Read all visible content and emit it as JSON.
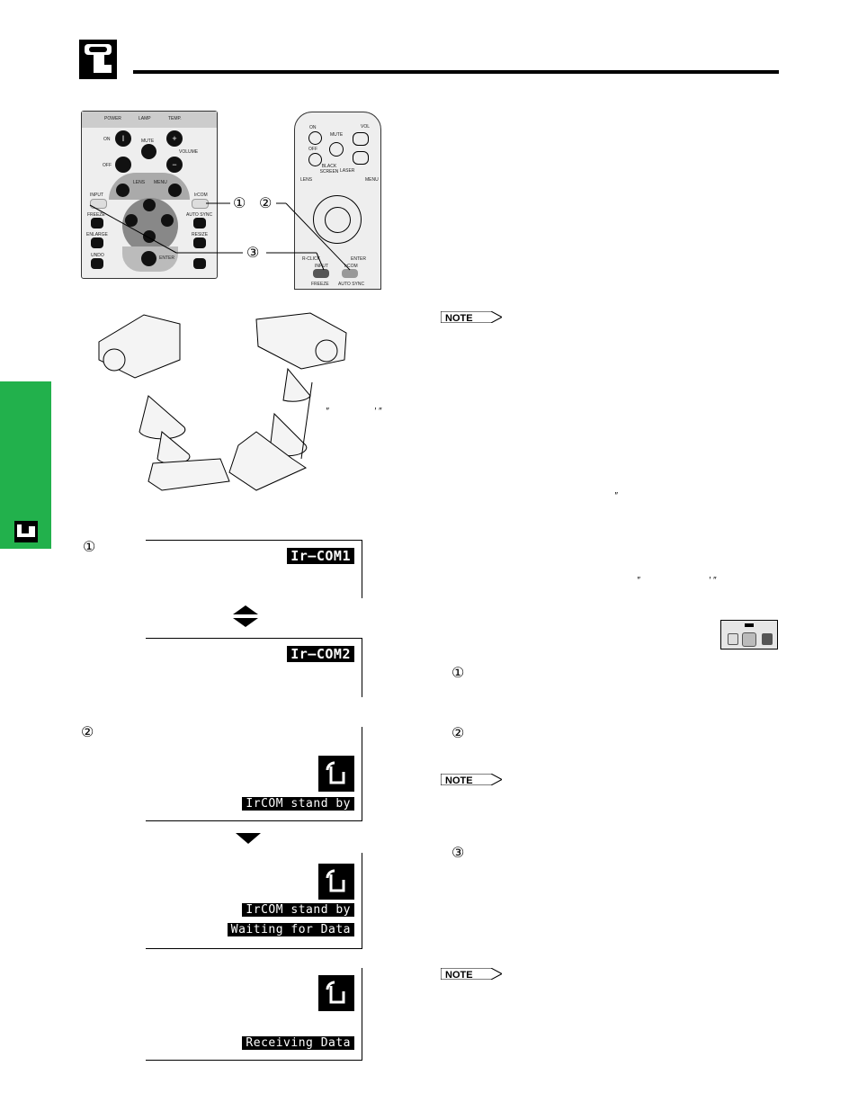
{
  "header": {
    "icon": "hand-pointer-icon"
  },
  "side_tab": {
    "color": "#22b14c",
    "icon": "projector-laptop-icon"
  },
  "remote_large": {
    "indicators": [
      "POWER",
      "LAMP",
      "TEMP."
    ],
    "labels": {
      "on": "ON",
      "mute": "MUTE",
      "volume": "VOLUME",
      "off": "OFF",
      "lens": "LENS",
      "menu": "MENU",
      "input": "INPUT",
      "ircom": "IrCOM",
      "freeze": "FREEZE",
      "auto_sync": "AUTO SYNC",
      "enlarge": "ENLARGE",
      "resize": "RESIZE",
      "undo": "UNDO",
      "enter": "ENTER"
    },
    "on_glyph": "I",
    "plus": "+",
    "minus": "−"
  },
  "remote_small": {
    "labels": {
      "on": "ON",
      "mute": "MUTE",
      "vol": "VOL",
      "off": "OFF",
      "black_screen": "BLACK SCREEN",
      "laser": "LASER",
      "lens": "LENS",
      "menu": "MENU",
      "r_click": "R-CLICK",
      "enter": "ENTER",
      "input": "INPUT",
      "ircom": "IrCOM",
      "freeze": "FREEZE",
      "auto_sync": "AUTO SYNC"
    }
  },
  "callouts": {
    "one": "①",
    "two": "②",
    "three": "③"
  },
  "quotes": {
    "q1": "″",
    "q2": "′ ″",
    "q3": "″",
    "q4": "″",
    "q5": "′ ″"
  },
  "osd": {
    "ircom1": "Ir—COM1",
    "ircom2": "Ir—COM2",
    "standby": "IrCOM stand by",
    "waiting": "Waiting for Data",
    "receiving": "Receiving Data"
  },
  "notes": [
    "NOTE",
    "NOTE",
    "NOTE"
  ],
  "steps": [
    "①",
    "②",
    "③"
  ]
}
